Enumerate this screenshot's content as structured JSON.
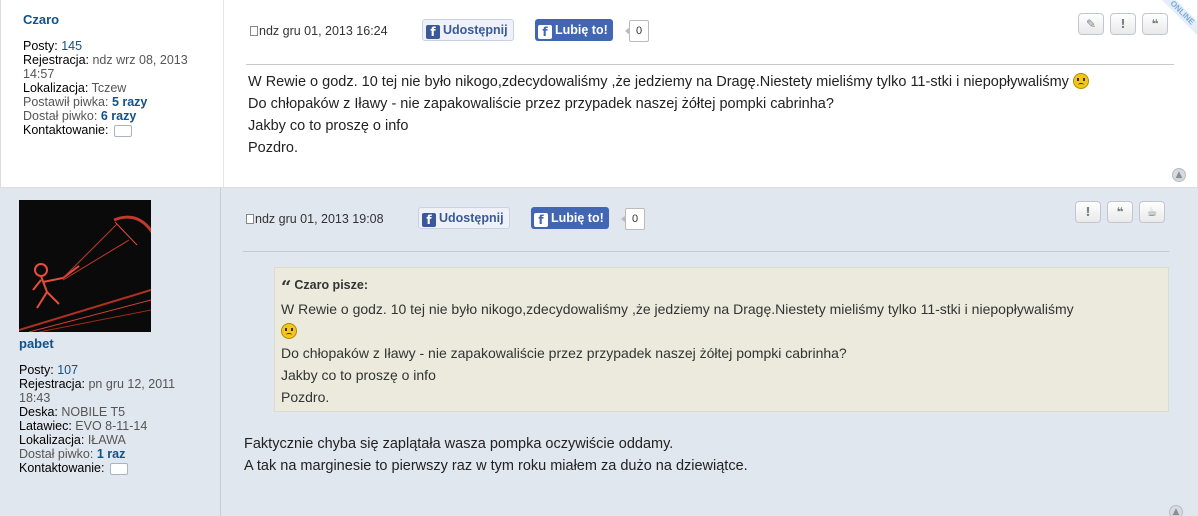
{
  "posts": [
    {
      "author": {
        "username": "Czaro",
        "posty_label": "Posty:",
        "posty_value": "145",
        "rejestracja_label": "Rejestracja:",
        "rejestracja_value_line1": "ndz wrz 08, 2013",
        "rejestracja_value_line2": "14:57",
        "lokalizacja_label": "Lokalizacja:",
        "lokalizacja_value": "Tczew",
        "postawil_label": "Postawił piwka:",
        "postawil_value": "5 razy",
        "dostal_label": "Dostał piwko:",
        "dostal_value": "6 razy",
        "kontakt_label": "Kontaktowanie:"
      },
      "date": "ndz gru 01, 2013 16:24",
      "share_label": "Udostępnij",
      "like_label": "Lubię to!",
      "like_count": "0",
      "online_label": "ONLINE",
      "actions": [
        {
          "icon": "edit-icon",
          "glyph": "✎"
        },
        {
          "icon": "report-icon",
          "glyph": "!"
        },
        {
          "icon": "quote-icon",
          "glyph": "❝"
        }
      ],
      "content": [
        "W Rewie o godz. 10 tej nie było nikogo,zdecydowaliśmy ,że jedziemy na Dragę.Niestety mieliśmy tylko 11-stki i niepopływaliśmy",
        "Do chłopaków z Iławy - nie zapakowaliście przez przypadek naszej żółtej pompki cabrinha?",
        "Jakby co to proszę o info",
        "Pozdro."
      ]
    },
    {
      "author": {
        "username": "pabet",
        "posty_label": "Posty:",
        "posty_value": "107",
        "rejestracja_label": "Rejestracja:",
        "rejestracja_value_line1": "pn gru 12, 2011",
        "rejestracja_value_line2": "18:43",
        "deska_label": "Deska:",
        "deska_value": "NOBILE T5",
        "latawiec_label": "Latawiec:",
        "latawiec_value": "EVO 8-11-14",
        "lokalizacja_label": "Lokalizacja:",
        "lokalizacja_value": "IŁAWA",
        "dostal_label": "Dostał piwko:",
        "dostal_value": "1 raz",
        "kontakt_label": "Kontaktowanie:"
      },
      "date": "ndz gru 01, 2013 19:08",
      "share_label": "Udostępnij",
      "like_label": "Lubię to!",
      "like_count": "0",
      "actions": [
        {
          "icon": "report-icon",
          "glyph": "!"
        },
        {
          "icon": "quote-icon",
          "glyph": "❝"
        },
        {
          "icon": "beer-icon",
          "glyph": "☕"
        }
      ],
      "quote": {
        "cite": "Czaro pisze:",
        "lines": [
          "W Rewie o godz. 10 tej nie było nikogo,zdecydowaliśmy ,że jedziemy na Dragę.Niestety mieliśmy tylko 11-stki i niepopływaliśmy",
          "Do chłopaków z Iławy - nie zapakowaliście przez przypadek naszej żółtej pompki cabrinha?",
          "Jakby co to proszę o info",
          "Pozdro."
        ]
      },
      "content": [
        "Faktycznie chyba się zaplątała wasza pompka oczywiście oddamy.",
        "A tak na marginesie to pierwszy raz w tym roku miałem za dużo na dziewiątce."
      ]
    }
  ],
  "colors": {
    "link": "#105289",
    "post_alt_bg": "#e1e7ee",
    "quote_bg": "#ebeadd",
    "fb_blue": "#4267b2"
  }
}
